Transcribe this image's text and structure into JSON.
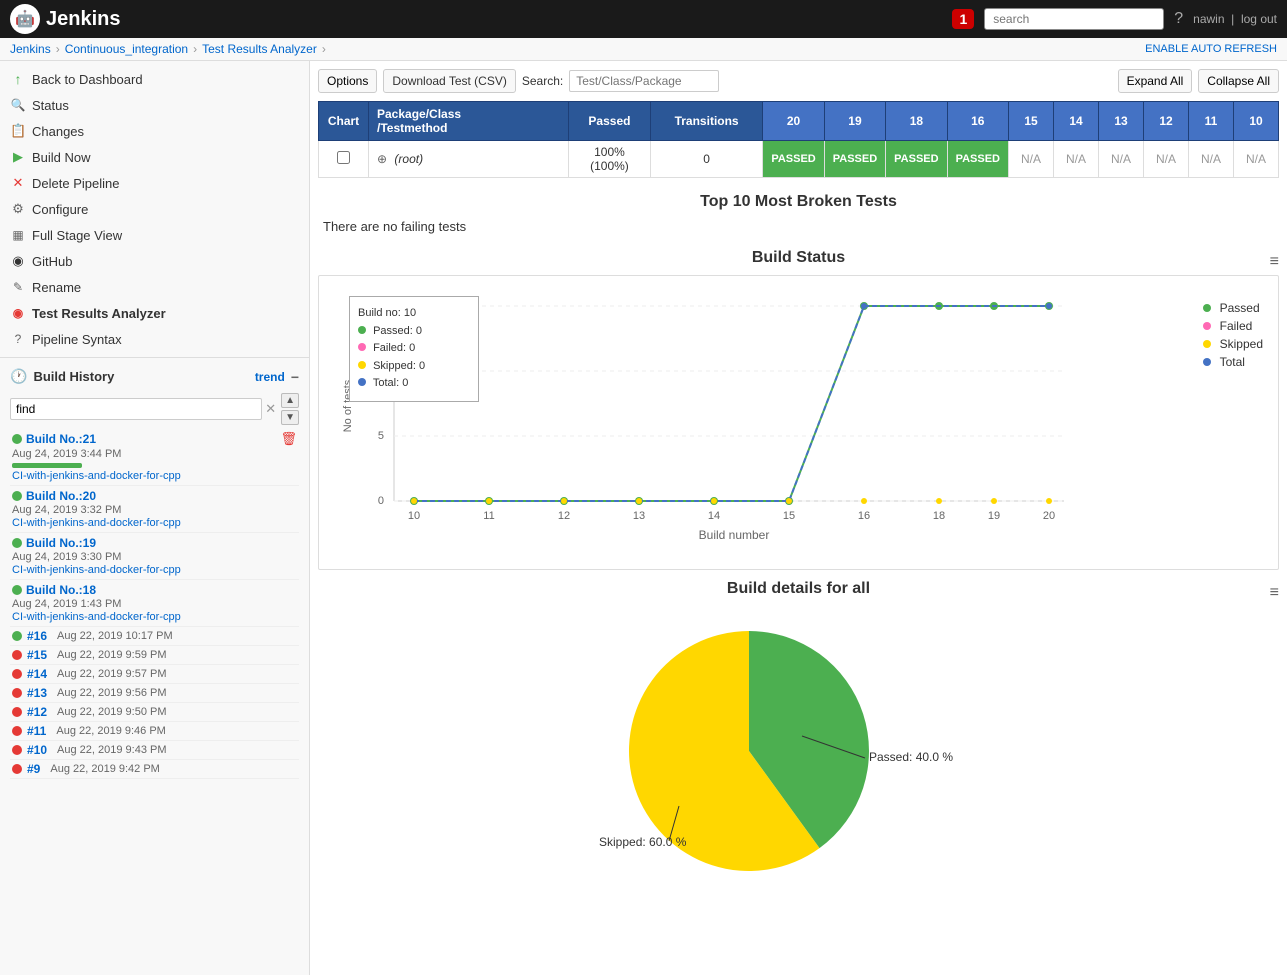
{
  "app": {
    "name": "Jenkins",
    "logo_char": "🤖"
  },
  "navbar": {
    "notification_count": "1",
    "search_placeholder": "search",
    "help_icon": "?",
    "username": "nawin",
    "logout_label": "log out"
  },
  "breadcrumb": {
    "items": [
      "Jenkins",
      "Continuous_integration",
      "Test Results Analyzer"
    ],
    "enable_auto_refresh": "ENABLE AUTO REFRESH"
  },
  "sidebar": {
    "menu_items": [
      {
        "id": "back-to-dashboard",
        "label": "Back to Dashboard",
        "icon": "↑",
        "icon_type": "up"
      },
      {
        "id": "status",
        "label": "Status",
        "icon": "🔍",
        "icon_type": "search"
      },
      {
        "id": "changes",
        "label": "Changes",
        "icon": "📋",
        "icon_type": "changes"
      },
      {
        "id": "build-now",
        "label": "Build Now",
        "icon": "▶",
        "icon_type": "play"
      },
      {
        "id": "delete-pipeline",
        "label": "Delete Pipeline",
        "icon": "✕",
        "icon_type": "delete"
      },
      {
        "id": "configure",
        "label": "Configure",
        "icon": "⚙",
        "icon_type": "gear"
      },
      {
        "id": "full-stage-view",
        "label": "Full Stage View",
        "icon": "▦",
        "icon_type": "stage"
      },
      {
        "id": "github",
        "label": "GitHub",
        "icon": "◉",
        "icon_type": "github"
      },
      {
        "id": "rename",
        "label": "Rename",
        "icon": "✎",
        "icon_type": "rename"
      },
      {
        "id": "test-results-analyzer",
        "label": "Test Results Analyzer",
        "icon": "◉",
        "icon_type": "tra",
        "active": true
      },
      {
        "id": "pipeline-syntax",
        "label": "Pipeline Syntax",
        "icon": "?",
        "icon_type": "pipeline"
      }
    ],
    "build_history": {
      "title": "Build History",
      "trend_label": "trend",
      "find_placeholder": "find",
      "builds_detailed": [
        {
          "num": "Build No.:21",
          "date": "Aug 24, 2019 3:44 PM",
          "branch": "CI-with-jenkins-and-docker-for-cpp",
          "status": "green",
          "has_progress": true
        },
        {
          "num": "Build No.:20",
          "date": "Aug 24, 2019 3:32 PM",
          "branch": "CI-with-jenkins-and-docker-for-cpp",
          "status": "green",
          "has_progress": false
        },
        {
          "num": "Build No.:19",
          "date": "Aug 24, 2019 3:30 PM",
          "branch": "CI-with-jenkins-and-docker-for-cpp",
          "status": "green",
          "has_progress": false
        },
        {
          "num": "Build No.:18",
          "date": "Aug 24, 2019 1:43 PM",
          "branch": "CI-with-jenkins-and-docker-for-cpp",
          "status": "green",
          "has_progress": false
        }
      ],
      "builds_short": [
        {
          "num": "#16",
          "date": "Aug 22, 2019 10:17 PM",
          "status": "green"
        },
        {
          "num": "#15",
          "date": "Aug 22, 2019 9:59 PM",
          "status": "red"
        },
        {
          "num": "#14",
          "date": "Aug 22, 2019 9:57 PM",
          "status": "red"
        },
        {
          "num": "#13",
          "date": "Aug 22, 2019 9:56 PM",
          "status": "red"
        },
        {
          "num": "#12",
          "date": "Aug 22, 2019 9:50 PM",
          "status": "red"
        },
        {
          "num": "#11",
          "date": "Aug 22, 2019 9:46 PM",
          "status": "red"
        },
        {
          "num": "#10",
          "date": "Aug 22, 2019 9:43 PM",
          "status": "red"
        },
        {
          "num": "#9",
          "date": "Aug 22, 2019 9:42 PM",
          "status": "red"
        }
      ]
    }
  },
  "toolbar": {
    "options_label": "Options",
    "download_label": "Download Test (CSV)",
    "search_label": "Search:",
    "search_placeholder": "Test/Class/Package",
    "expand_all_label": "Expand All",
    "collapse_all_label": "Collapse All"
  },
  "test_table": {
    "headers": {
      "chart": "Chart",
      "package": "Package/Class\n/Testmethod",
      "passed": "Passed",
      "transitions": "Transitions",
      "builds": [
        "20",
        "19",
        "18",
        "16",
        "15",
        "14",
        "13",
        "12",
        "11",
        "10"
      ]
    },
    "rows": [
      {
        "chart_checked": false,
        "expand_icon": "⊕",
        "name": "(root)",
        "passed": "100% (100%)",
        "transitions": "0",
        "build_statuses": [
          "PASSED",
          "PASSED",
          "PASSED",
          "PASSED",
          "N/A",
          "N/A",
          "N/A",
          "N/A",
          "N/A",
          "N/A"
        ]
      }
    ]
  },
  "top_broken": {
    "title": "Top 10 Most Broken Tests",
    "no_failing_msg": "There are no failing tests"
  },
  "build_status_chart": {
    "title": "Build Status",
    "tooltip": {
      "build_no": "Build no: 10",
      "passed_label": "Passed:",
      "passed_val": "0",
      "failed_label": "Failed:",
      "failed_val": "0",
      "skipped_label": "Skipped:",
      "skipped_val": "0",
      "total_label": "Total:",
      "total_val": "0"
    },
    "y_axis_label": "No of tests",
    "x_axis_label": "Build number",
    "y_ticks": [
      "0",
      "5",
      "10",
      "15"
    ],
    "x_ticks": [
      "10",
      "11",
      "12",
      "13",
      "14",
      "15",
      "16",
      "18",
      "19",
      "20"
    ],
    "legend": [
      {
        "label": "Passed",
        "color": "#4caf50"
      },
      {
        "label": "Failed",
        "color": "#ff69b4"
      },
      {
        "label": "Skipped",
        "color": "#ffd700"
      },
      {
        "label": "Total",
        "color": "#4472c4"
      }
    ],
    "data": {
      "passed": [
        0,
        0,
        0,
        0,
        0,
        0,
        15,
        15,
        15,
        15
      ],
      "failed": [
        0,
        0,
        0,
        0,
        0,
        0,
        0,
        0,
        0,
        0
      ],
      "skipped": [
        0,
        0,
        0,
        0,
        0,
        0,
        0,
        0,
        0,
        0
      ],
      "total": [
        0,
        0,
        0,
        0,
        0,
        0,
        15,
        15,
        15,
        15
      ]
    }
  },
  "build_details": {
    "title": "Build details for all",
    "pie_data": [
      {
        "label": "Passed: 40.0 %",
        "value": 40,
        "color": "#4caf50"
      },
      {
        "label": "Skipped: 60.0 %",
        "value": 60,
        "color": "#ffd700"
      }
    ]
  }
}
